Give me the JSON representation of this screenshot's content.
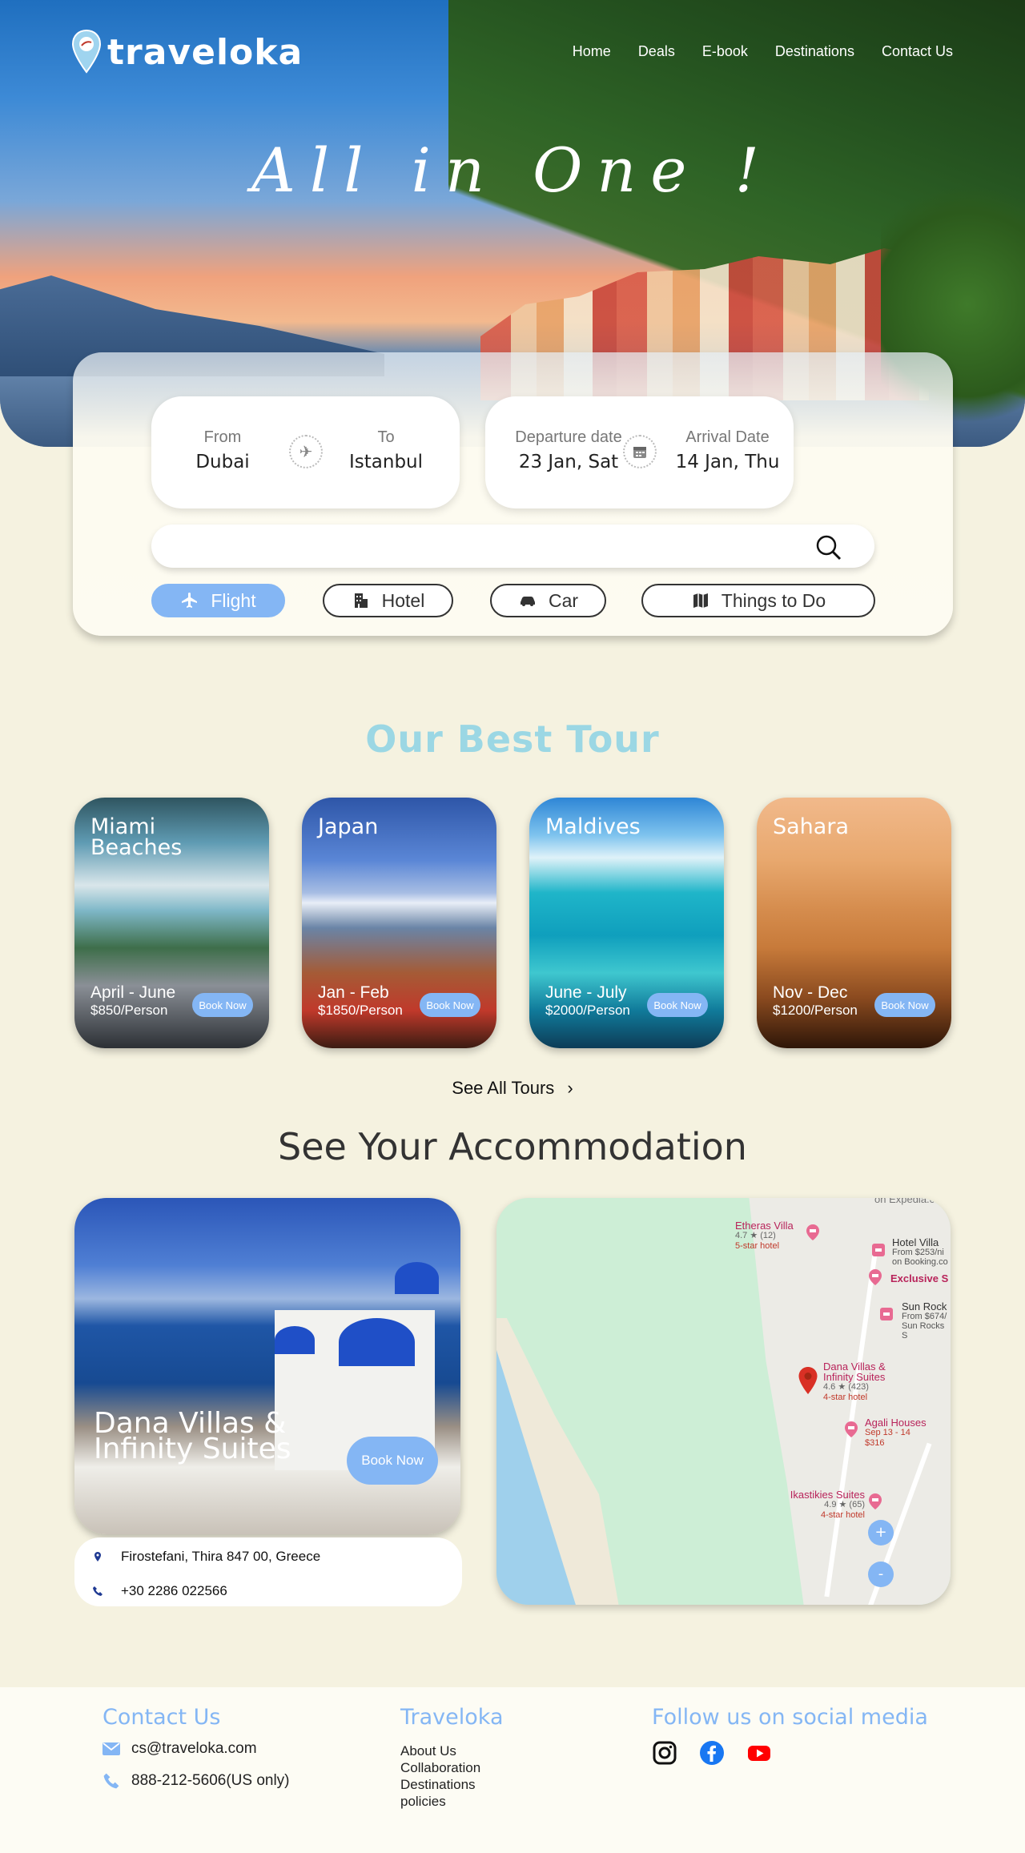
{
  "brand": {
    "name": "traveloka"
  },
  "nav": [
    "Home",
    "Deals",
    "E-book",
    "Destinations",
    "Contact Us"
  ],
  "hero": {
    "tagline": "All in One !"
  },
  "search": {
    "from_label": "From",
    "from_value": "Dubai",
    "to_label": "To",
    "to_value": "Istanbul",
    "departure_label": "Departure date",
    "departure_value": "23 Jan, Sat",
    "arrival_label": "Arrival Date",
    "arrival_value": "14 Jan, Thu",
    "query_placeholder": ""
  },
  "categories": [
    {
      "label": "Flight",
      "icon": "plane-icon",
      "active": true
    },
    {
      "label": "Hotel",
      "icon": "hotel-icon",
      "active": false
    },
    {
      "label": "Car",
      "icon": "car-icon",
      "active": false
    },
    {
      "label": "Things to Do",
      "icon": "map-icon",
      "active": false
    }
  ],
  "tours": {
    "title": "Our Best Tour",
    "items": [
      {
        "name": "Miami Beaches",
        "dates": "April - June",
        "price": "$850/Person",
        "button": "Book Now"
      },
      {
        "name": "Japan",
        "dates": "Jan - Feb",
        "price": "$1850/Person",
        "button": "Book Now"
      },
      {
        "name": "Maldives",
        "dates": "June - July",
        "price": "$2000/Person",
        "button": "Book Now"
      },
      {
        "name": "Sahara",
        "dates": "Nov - Dec",
        "price": "$1200/Person",
        "button": "Book Now"
      }
    ],
    "see_all": "See All Tours"
  },
  "accommodation": {
    "title": "See Your Accommodation",
    "name": "Dana Villas & Infinity Suites",
    "button": "Book Now",
    "address": "Firostefani, Thira 847 00, Greece",
    "phone": "+30 2286 022566",
    "map": {
      "top_clip": "on Expedia.com",
      "places": [
        {
          "name": "Etheras Villa",
          "rating": "4.7 ★ (12)",
          "type": "5-star hotel"
        },
        {
          "name": "Hotel Villa",
          "detail": "From $253/ni",
          "detail2": "on Booking.co"
        },
        {
          "name": "Exclusive S"
        },
        {
          "name": "Sun Rock",
          "detail": "From $674/",
          "detail2": "Sun Rocks S"
        },
        {
          "name": "Dana Villas & Infinity Suites",
          "rating": "4.6 ★ (423)",
          "type": "4-star hotel"
        },
        {
          "name": "Agali Houses",
          "detail": "Sep 13 - 14",
          "detail2": "$316"
        },
        {
          "name": "Ikastikies Suites",
          "rating": "4.9 ★ (65)",
          "type": "4-star hotel"
        }
      ],
      "zoom_in": "+",
      "zoom_out": "-"
    }
  },
  "footer": {
    "contact_title": "Contact Us",
    "email": "cs@traveloka.com",
    "phone": "888-212-5606(US only)",
    "company_title": "Traveloka",
    "links": [
      "About Us",
      "Collaboration",
      "Destinations",
      "policies"
    ],
    "social_title": "Follow us on social media",
    "social": [
      "instagram-icon",
      "facebook-icon",
      "youtube-icon"
    ]
  },
  "colors": {
    "accent": "#84b6f4",
    "background": "#f5f2e0",
    "tour_title": "#9bd7e4"
  }
}
